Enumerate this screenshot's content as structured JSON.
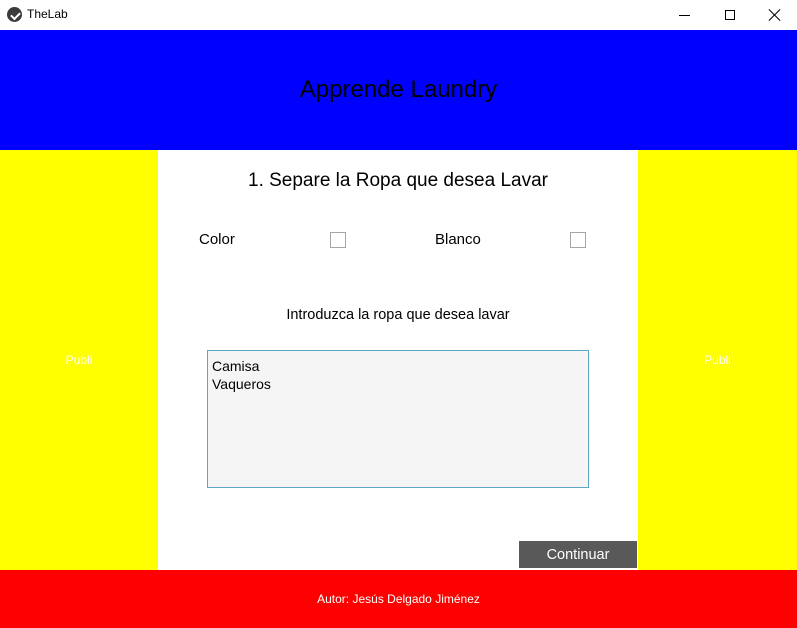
{
  "window": {
    "title": "TheLab",
    "app_icon": "app-logo-icon",
    "controls": [
      "minimize-icon",
      "maximize-icon",
      "close-icon"
    ]
  },
  "header": {
    "title": "Apprende Laundry",
    "background": "#0000ff"
  },
  "ads": {
    "left_label": "Publi",
    "right_label": "Publi",
    "background": "#ffff00"
  },
  "main": {
    "step_title": "1. Separe la Ropa que desea Lavar",
    "options": {
      "color_label": "Color",
      "color_checked": false,
      "blanco_label": "Blanco",
      "blanco_checked": false
    },
    "prompt": "Introduzca la ropa que desea lavar",
    "clothes_input_value": "Camisa\nVaqueros",
    "continue_label": "Continuar"
  },
  "footer": {
    "author": "Autor: Jesús Delgado Jiménez",
    "background": "#ff0000"
  }
}
